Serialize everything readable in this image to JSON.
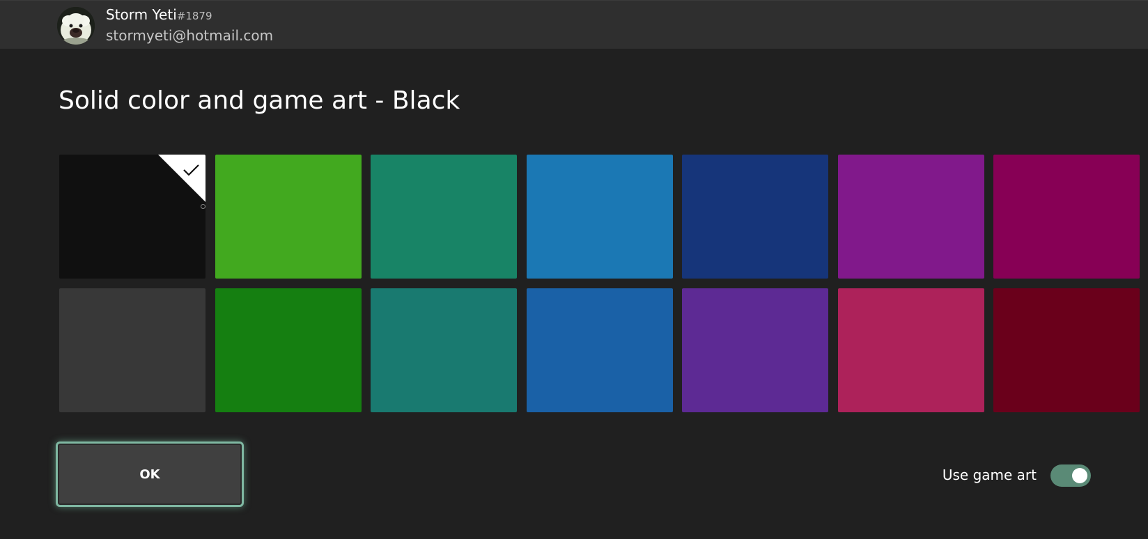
{
  "account": {
    "gamertag": "Storm Yeti",
    "gamertag_suffix": "#1879",
    "email": "stormyeti@hotmail.com",
    "avatar_icon": "yeti-avatar-icon"
  },
  "page": {
    "title": "Solid color and game art - Black"
  },
  "colors": {
    "selected_index": 0,
    "swatches": [
      {
        "name": "Black",
        "hex": "#101010"
      },
      {
        "name": "Green",
        "hex": "#42a91f"
      },
      {
        "name": "Teal green",
        "hex": "#188466"
      },
      {
        "name": "Light blue",
        "hex": "#1b78b4"
      },
      {
        "name": "Navy",
        "hex": "#16357a"
      },
      {
        "name": "Purple",
        "hex": "#81198b"
      },
      {
        "name": "Magenta",
        "hex": "#870055"
      },
      {
        "name": "Dark gray",
        "hex": "#383838"
      },
      {
        "name": "Dark green",
        "hex": "#157f11"
      },
      {
        "name": "Dark teal",
        "hex": "#197a70"
      },
      {
        "name": "Blue",
        "hex": "#1a61a7"
      },
      {
        "name": "Violet",
        "hex": "#5d2a94"
      },
      {
        "name": "Pink",
        "hex": "#ad225a"
      },
      {
        "name": "Maroon",
        "hex": "#6a001b"
      }
    ]
  },
  "actions": {
    "ok_label": "OK"
  },
  "game_art": {
    "label": "Use game art",
    "enabled": true,
    "accent": "#5a8a76"
  }
}
